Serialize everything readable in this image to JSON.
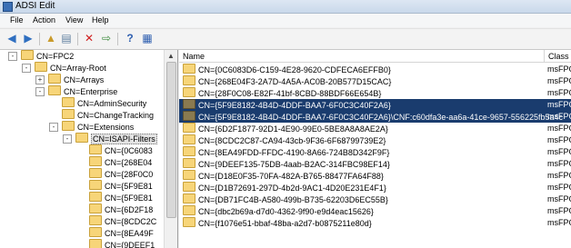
{
  "window": {
    "title": "ADSI Edit"
  },
  "menu": [
    "File",
    "Action",
    "View",
    "Help"
  ],
  "toolbar": [
    "back-icon",
    "forward-icon",
    "up-folder-icon",
    "show-hide-tree-icon",
    "delete-icon",
    "export-icon",
    "help-icon",
    "properties-icon"
  ],
  "tree": {
    "items": [
      {
        "label": "CN=FPC2",
        "expander": "-",
        "depth": 0
      },
      {
        "label": "CN=Array-Root",
        "expander": "-",
        "depth": 1
      },
      {
        "label": "CN=Arrays",
        "expander": "+",
        "depth": 2
      },
      {
        "label": "CN=Enterprise",
        "expander": "-",
        "depth": 2
      },
      {
        "label": "CN=AdminSecurity",
        "expander": "",
        "depth": 3
      },
      {
        "label": "CN=ChangeTracking",
        "expander": "",
        "depth": 3
      },
      {
        "label": "CN=Extensions",
        "expander": "-",
        "depth": 3
      },
      {
        "label": "CN=ISAPI-Filters",
        "expander": "-",
        "depth": 4,
        "selected": true
      },
      {
        "label": "CN={0C6083",
        "expander": "",
        "depth": 5
      },
      {
        "label": "CN={268E04",
        "expander": "",
        "depth": 5
      },
      {
        "label": "CN={28F0C0",
        "expander": "",
        "depth": 5
      },
      {
        "label": "CN={5F9E81",
        "expander": "",
        "depth": 5
      },
      {
        "label": "CN={5F9E81",
        "expander": "",
        "depth": 5
      },
      {
        "label": "CN={6D2F18",
        "expander": "",
        "depth": 5
      },
      {
        "label": "CN={8CDC2C",
        "expander": "",
        "depth": 5
      },
      {
        "label": "CN={8EA49F",
        "expander": "",
        "depth": 5
      },
      {
        "label": "CN={9DEEF1",
        "expander": "",
        "depth": 5
      }
    ]
  },
  "list": {
    "columns": {
      "name": "Name",
      "class": "Class"
    },
    "rows": [
      {
        "name": "CN={0C6083D6-C159-4E28-9620-CDFECA6EFFB0}",
        "class": "msFPC"
      },
      {
        "name": "CN={268E04F3-2A7D-4A5A-AC0B-20B577D15CAC}",
        "class": "msFPC"
      },
      {
        "name": "CN={28F0C08-E82F-41bf-8CBD-88BDF66E654B}",
        "class": "msFPC"
      },
      {
        "name": "CN={5F9E8182-4B4D-4DDF-BAA7-6F0C3C40F2A6}",
        "class": "msFPC",
        "selected": true
      },
      {
        "name": "CN={5F9E8182-4B4D-4DDF-BAA7-6F0C3C40F2A6}\\CNF:c60dfa3e-aa6a-41ce-9657-556225fb5a4c",
        "class": "msFPC",
        "selected": true
      },
      {
        "name": "CN={6D2F1877-92D1-4E90-99E0-5BE8A8A8AE2A}",
        "class": "msFPC"
      },
      {
        "name": "CN={8CDC2C87-CA94-43cb-9F36-6F68799739E2}",
        "class": "msFPC"
      },
      {
        "name": "CN={8EA49FDD-FFDC-4190-8A66-724B8D342F9F}",
        "class": "msFPC"
      },
      {
        "name": "CN={9DEEF135-75DB-4aab-B2AC-314FBC98EF14}",
        "class": "msFPC"
      },
      {
        "name": "CN={D18E0F35-70FA-482A-B765-88477FA64F88}",
        "class": "msFPC"
      },
      {
        "name": "CN={D1B72691-297D-4b2d-9AC1-4D20E231E4F1}",
        "class": "msFPC"
      },
      {
        "name": "CN={DB71FC4B-A580-499b-B735-62203D6EC55B}",
        "class": "msFPC"
      },
      {
        "name": "CN={dbc2b69a-d7d0-4362-9f90-e9d4eac15626}",
        "class": "msFPC"
      },
      {
        "name": "CN={f1076e51-bbaf-48ba-a2d7-b0875211e80d}",
        "class": "msFPC"
      }
    ]
  }
}
